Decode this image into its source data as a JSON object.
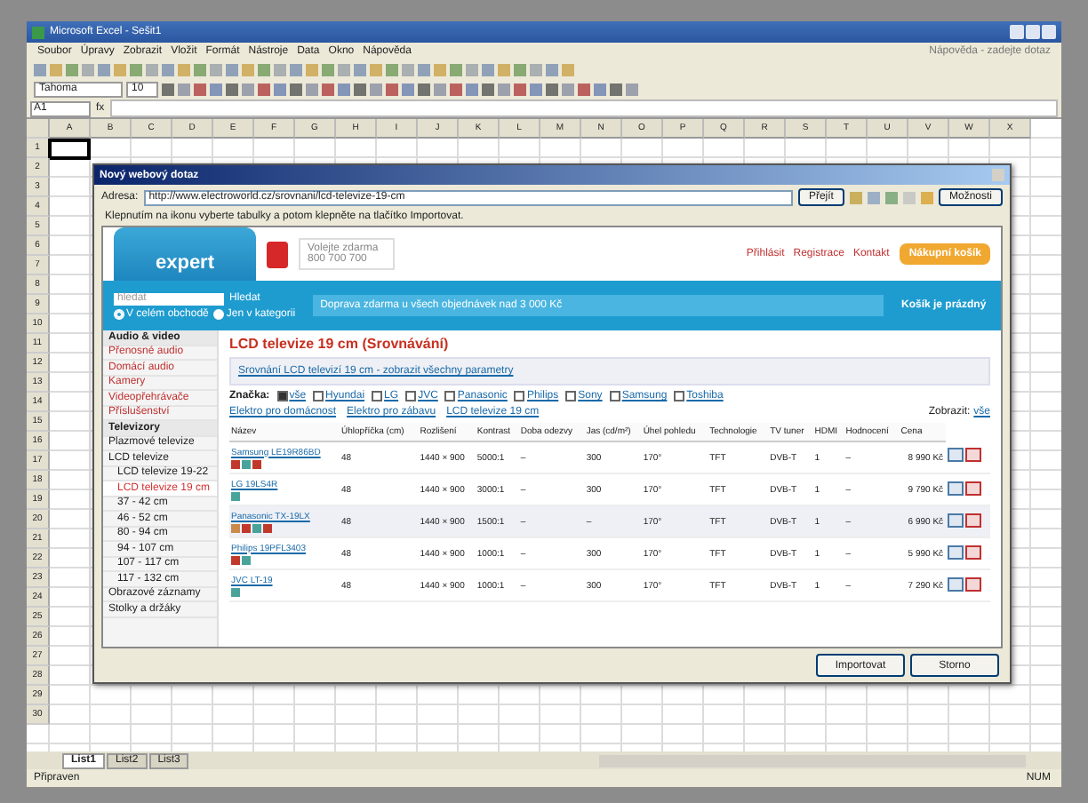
{
  "excel": {
    "title": "Microsoft Excel - Sešit1",
    "menu": [
      "Soubor",
      "Úpravy",
      "Zobrazit",
      "Vložit",
      "Formát",
      "Nástroje",
      "Data",
      "Okno",
      "Nápověda"
    ],
    "help_box": {
      "placeholder": "Nápověda - zadejte dotaz"
    },
    "font": "Tahoma",
    "font_size": "10",
    "name_box": "A1",
    "formula_label": "fx",
    "rows": [
      "1",
      "2",
      "3",
      "4",
      "5",
      "6",
      "7",
      "8",
      "9",
      "10",
      "11",
      "12",
      "13",
      "14",
      "15",
      "16",
      "17",
      "18",
      "19",
      "20",
      "21",
      "22",
      "23",
      "24",
      "25",
      "26",
      "27",
      "28",
      "29",
      "30"
    ],
    "columns": [
      "A",
      "B",
      "C",
      "D",
      "E",
      "F",
      "G",
      "H",
      "I",
      "J",
      "K",
      "L",
      "M",
      "N",
      "O",
      "P",
      "Q",
      "R",
      "S",
      "T",
      "U",
      "V",
      "W",
      "X"
    ],
    "sheet_tabs": [
      {
        "label": "List1",
        "selected": true
      },
      {
        "label": "List2",
        "selected": false
      },
      {
        "label": "List3",
        "selected": false
      }
    ],
    "status_bar": "Připraven",
    "status_right": "NUM"
  },
  "dialog": {
    "title": "Nový webový dotaz",
    "address_label": "Adresa:",
    "address": "http://www.electroworld.cz/srovnani/lcd-televize-19-cm",
    "go_button": "Přejít",
    "options_button": "Možnosti",
    "hint": "Klepnutím na ikonu vyberte tabulky a potom klepněte na tlačítko Importovat.",
    "page": {
      "logo": "expert",
      "ad_text": "Volejte zdarma 800 700 700",
      "top_links": [
        "Přihlásit",
        "Registrace",
        "Kontakt"
      ],
      "basket": "Nákupní košík",
      "search": {
        "placeholder": "hledat"
      },
      "search_button": "Hledat",
      "search_options": [
        {
          "label": "V celém obchodě",
          "selected": true
        },
        {
          "label": "Jen v kategorii",
          "selected": false
        }
      ],
      "banner": "Doprava zdarma u všech objednávek nad 3 000 Kč",
      "cart_info": "Košík je prázdný",
      "sidebar": [
        {
          "label": "Audio & video",
          "kind": "header",
          "selected": false
        },
        {
          "label": "Přenosné audio",
          "kind": "link",
          "selected": false
        },
        {
          "label": "Domácí audio",
          "kind": "link",
          "selected": false
        },
        {
          "label": "Kamery",
          "kind": "link",
          "selected": false
        },
        {
          "label": "Videopřehrávače",
          "kind": "link",
          "selected": false
        },
        {
          "label": "Příslušenství",
          "kind": "link",
          "selected": false
        },
        {
          "label": "Televizory",
          "kind": "header",
          "selected": false
        },
        {
          "label": "Plazmové televize",
          "kind": "item",
          "selected": false
        },
        {
          "label": "LCD televize",
          "kind": "item",
          "selected": false,
          "children": [
            {
              "label": "LCD televize 19-22",
              "selected": false
            },
            {
              "label": "LCD televize 19 cm",
              "selected": true
            },
            {
              "label": "37 - 42 cm",
              "selected": false
            },
            {
              "label": "46 - 52 cm",
              "selected": false
            },
            {
              "label": "80 - 94 cm",
              "selected": false
            },
            {
              "label": "94 - 107 cm",
              "selected": false
            },
            {
              "label": "107 - 117 cm",
              "selected": false
            },
            {
              "label": "117 - 132 cm",
              "selected": false
            }
          ]
        },
        {
          "label": "Obrazové záznamy",
          "kind": "item",
          "selected": false
        },
        {
          "label": "Stolky a držáky",
          "kind": "item",
          "selected": false
        }
      ],
      "heading": "LCD televize 19 cm (Srovnávání)",
      "notice_link": "Srovnání LCD televizí 19 cm - zobrazit všechny parametry",
      "brand_label": "Značka:",
      "brands": [
        {
          "label": "vše",
          "checked": true
        },
        {
          "label": "Hyundai",
          "checked": false
        },
        {
          "label": "LG",
          "checked": false
        },
        {
          "label": "JVC",
          "checked": false
        },
        {
          "label": "Panasonic",
          "checked": false
        },
        {
          "label": "Philips",
          "checked": false
        },
        {
          "label": "Sony",
          "checked": false
        },
        {
          "label": "Samsung",
          "checked": false
        },
        {
          "label": "Toshiba",
          "checked": false
        }
      ],
      "breadcrumb": [
        "Elektro pro domácnost",
        "Elektro pro zábavu",
        "LCD televize 19 cm"
      ],
      "view_label": "Zobrazit:",
      "view_link": "vše",
      "table": {
        "columns": [
          "Název",
          "Úhlopříčka (cm)",
          "Rozlišení",
          "Kontrast",
          "Doba odezvy",
          "Jas (cd/m²)",
          "Úhel pohledu",
          "Technologie",
          "TV tuner",
          "HDMI",
          "Hodnocení",
          "Cena"
        ],
        "rows": [
          {
            "cells": [
              "Samsung LE19R86BD",
              "48",
              "1440 × 900",
              "5000:1",
              "–",
              "300",
              "170°",
              "TFT",
              "DVB-T",
              "1",
              "–",
              "8 990 Kč"
            ],
            "tags": [
              {
                "color": "#c0392b"
              },
              {
                "color": "#4aa39a"
              },
              {
                "color": "#c0392b"
              }
            ],
            "shaded": false
          },
          {
            "cells": [
              "LG 19LS4R",
              "48",
              "1440 × 900",
              "3000:1",
              "–",
              "300",
              "170°",
              "TFT",
              "DVB-T",
              "1",
              "–",
              "9 790 Kč"
            ],
            "tags": [
              {
                "color": "#4aa39a"
              }
            ],
            "shaded": false
          },
          {
            "cells": [
              "Panasonic TX-19LX",
              "48",
              "1440 × 900",
              "1500:1",
              "–",
              "–",
              "170°",
              "TFT",
              "DVB-T",
              "1",
              "–",
              "6 990 Kč"
            ],
            "tags": [
              {
                "color": "#c98a4a"
              },
              {
                "color": "#c0392b"
              },
              {
                "color": "#4aa39a"
              },
              {
                "color": "#c0392b"
              }
            ],
            "shaded": true
          },
          {
            "cells": [
              "Philips 19PFL3403",
              "48",
              "1440 × 900",
              "1000:1",
              "–",
              "300",
              "170°",
              "TFT",
              "DVB-T",
              "1",
              "–",
              "5 990 Kč"
            ],
            "tags": [
              {
                "color": "#c0392b"
              },
              {
                "color": "#4aa39a"
              }
            ],
            "shaded": false
          },
          {
            "cells": [
              "JVC LT-19",
              "48",
              "1440 × 900",
              "1000:1",
              "–",
              "300",
              "170°",
              "TFT",
              "DVB-T",
              "1",
              "–",
              "7 290 Kč"
            ],
            "tags": [
              {
                "color": "#4aa39a"
              }
            ],
            "shaded": false
          }
        ]
      }
    },
    "buttons": [
      "Importovat",
      "Storno"
    ]
  }
}
